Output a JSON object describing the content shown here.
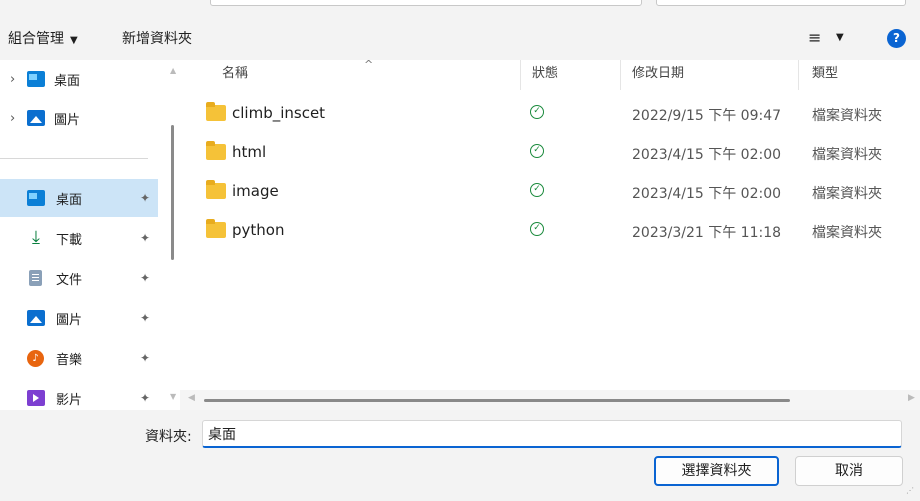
{
  "toolbar": {
    "organize_label": "組合管理",
    "organize_caret": "▼",
    "new_folder_label": "新增資料夾",
    "view_icon_glyph": "≡",
    "view_caret": "▼",
    "help_glyph": "?"
  },
  "nav": {
    "items": [
      {
        "label": "桌面",
        "icon": "desktop-icon",
        "expandable": true,
        "pinned": false,
        "selected": false
      },
      {
        "label": "圖片",
        "icon": "pictures-icon",
        "expandable": true,
        "pinned": false,
        "selected": false
      },
      {
        "label": "桌面",
        "icon": "desktop-icon",
        "expandable": false,
        "pinned": true,
        "selected": true
      },
      {
        "label": "下載",
        "icon": "download-icon",
        "expandable": false,
        "pinned": true,
        "selected": false
      },
      {
        "label": "文件",
        "icon": "documents-icon",
        "expandable": false,
        "pinned": true,
        "selected": false
      },
      {
        "label": "圖片",
        "icon": "pictures-icon",
        "expandable": false,
        "pinned": true,
        "selected": false
      },
      {
        "label": "音樂",
        "icon": "music-icon",
        "expandable": false,
        "pinned": true,
        "selected": false
      },
      {
        "label": "影片",
        "icon": "videos-icon",
        "expandable": false,
        "pinned": true,
        "selected": false
      }
    ],
    "chevron_glyph": "›",
    "pin_glyph": "📌",
    "selected_color": "#cce4f7"
  },
  "filelist": {
    "columns": {
      "name": "名稱",
      "status": "狀態",
      "modified": "修改日期",
      "type": "類型"
    },
    "sort_caret": "^",
    "rows": [
      {
        "name": "climb_inscet",
        "status_glyph": "✓",
        "modified": "2022/9/15 下午 09:47",
        "type": "檔案資料夾"
      },
      {
        "name": "html",
        "status_glyph": "✓",
        "modified": "2023/4/15 下午 02:00",
        "type": "檔案資料夾"
      },
      {
        "name": "image",
        "status_glyph": "✓",
        "modified": "2023/4/15 下午 02:00",
        "type": "檔案資料夾"
      },
      {
        "name": "python",
        "status_glyph": "✓",
        "modified": "2023/3/21 下午 11:18",
        "type": "檔案資料夾"
      }
    ]
  },
  "footer": {
    "folder_label": "資料夾:",
    "folder_value": "桌面",
    "select_button": "選擇資料夾",
    "cancel_button": "取消"
  },
  "colors": {
    "accent": "#0a64d2",
    "folder": "#f5c238",
    "status_ok": "#1a8a3c"
  }
}
